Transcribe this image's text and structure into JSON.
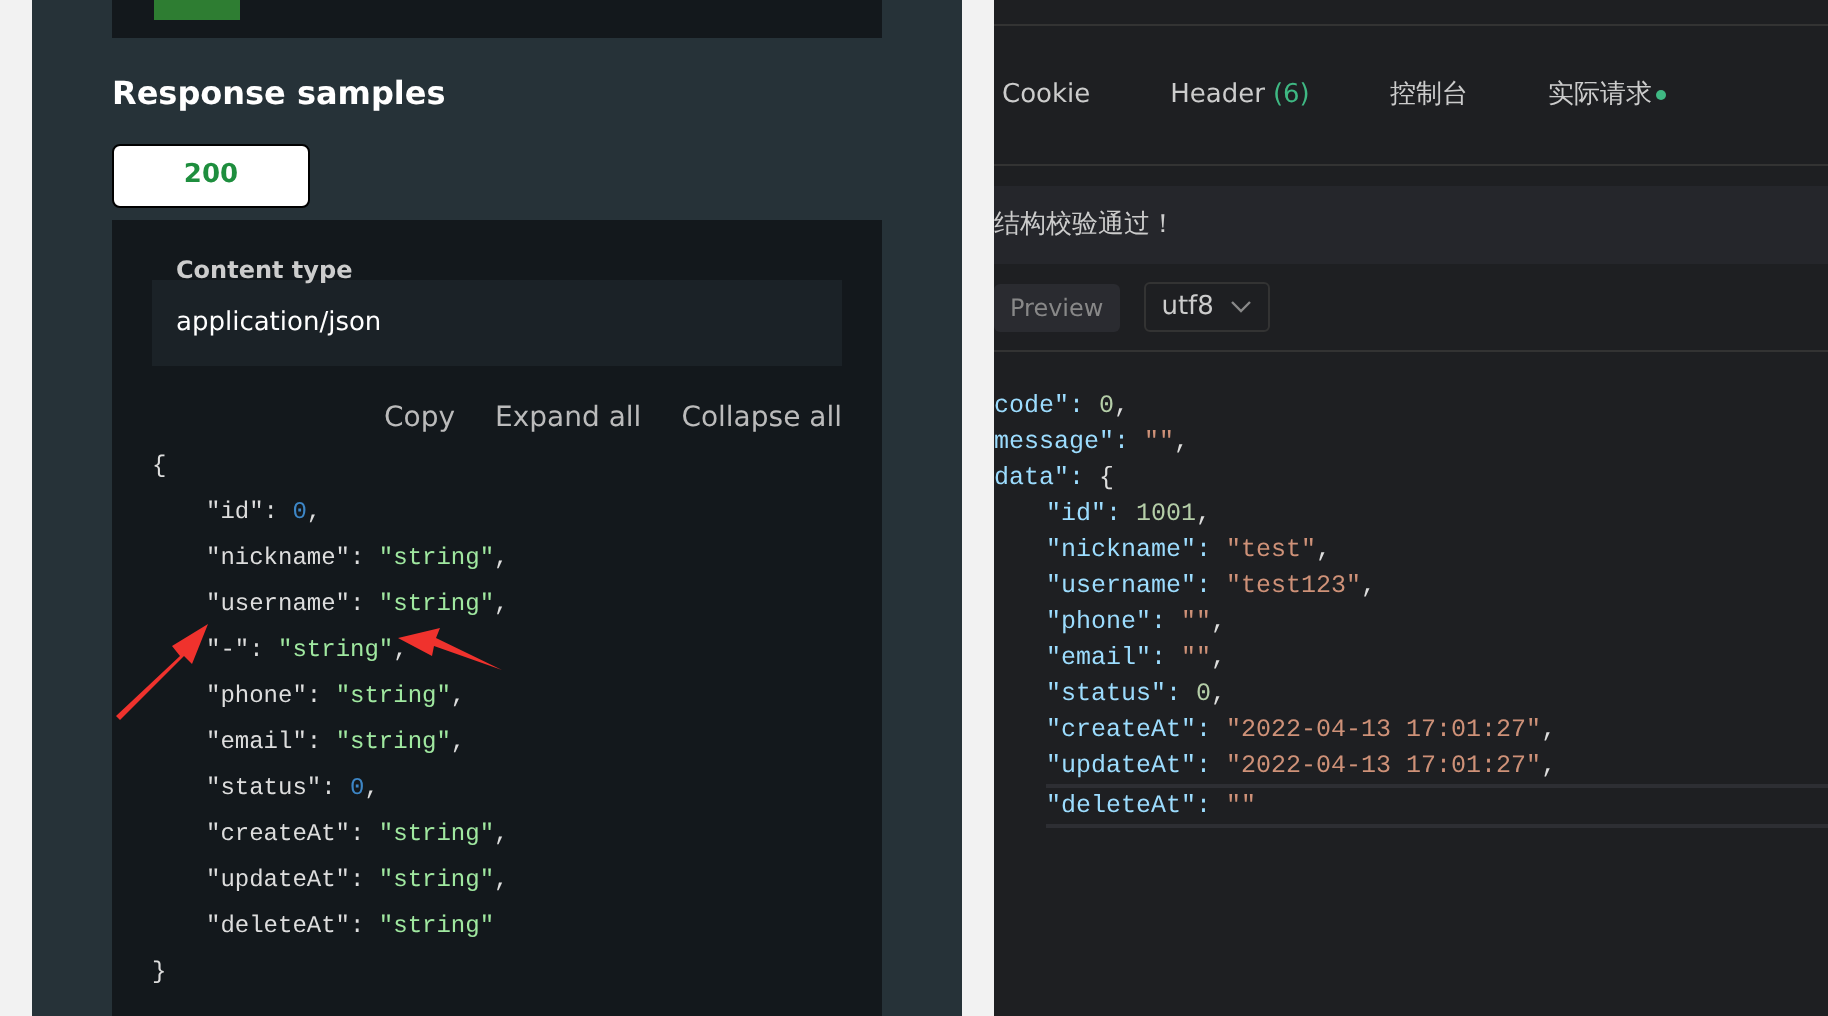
{
  "response_samples": {
    "title": "Response samples",
    "status_tabs": [
      {
        "label": "200",
        "selected": true
      }
    ],
    "content_type": {
      "label": "Content type",
      "value": "application/json"
    },
    "actions": [
      "Copy",
      "Expand all",
      "Collapse all"
    ],
    "code": [
      {
        "text": "{",
        "children": [
          {
            "key": "\"id\":",
            "value": "0",
            "kind": "number",
            "suffix": ","
          },
          {
            "key": "\"nickname\":",
            "value": "\"string\"",
            "kind": "string",
            "suffix": ","
          },
          {
            "key": "\"username\":",
            "value": "\"string\"",
            "kind": "string",
            "suffix": ","
          },
          {
            "key": "\"-\":",
            "value": "\"string\"",
            "kind": "string",
            "suffix": ","
          },
          {
            "key": "\"phone\":",
            "value": "\"string\"",
            "kind": "string",
            "suffix": ","
          },
          {
            "key": "\"email\":",
            "value": "\"string\"",
            "kind": "string",
            "suffix": ","
          },
          {
            "key": "\"status\":",
            "value": "0",
            "kind": "number",
            "suffix": ","
          },
          {
            "key": "\"createAt\":",
            "value": "\"string\"",
            "kind": "string",
            "suffix": ","
          },
          {
            "key": "\"updateAt\":",
            "value": "\"string\"",
            "kind": "string",
            "suffix": ","
          },
          {
            "key": "\"deleteAt\":",
            "value": "\"string\"",
            "kind": "string"
          }
        ]
      },
      {
        "text": "}"
      }
    ]
  },
  "response_panel": {
    "tabs": [
      {
        "label": "Cookie",
        "indicator": false
      },
      {
        "label": "Header",
        "count": "(6)",
        "indicator": false
      },
      {
        "label": "控制台",
        "indicator": false
      },
      {
        "label": "实际请求",
        "indicator": true
      }
    ],
    "banner": "结构校验通过！",
    "preview_button": "Preview",
    "encoding": "utf8",
    "code": [
      {
        "key": "code\":",
        "value": "0",
        "kind": "number",
        "suffix": ",",
        "highlighted": false
      },
      {
        "key": "message\":",
        "value": "\"\"",
        "kind": "string",
        "suffix": ",",
        "highlighted": false
      },
      {
        "key": "data\":",
        "value": "{",
        "kind": "brace",
        "highlighted": false,
        "children": [
          {
            "key": "\"id\":",
            "value": "1001",
            "kind": "number",
            "suffix": ",",
            "highlighted": false
          },
          {
            "key": "\"nickname\":",
            "value": "\"test\"",
            "kind": "string",
            "suffix": ",",
            "highlighted": false
          },
          {
            "key": "\"username\":",
            "value": "\"test123\"",
            "kind": "string",
            "suffix": ",",
            "highlighted": false
          },
          {
            "key": "\"phone\":",
            "value": "\"\"",
            "kind": "string",
            "suffix": ",",
            "highlighted": false
          },
          {
            "key": "\"email\":",
            "value": "\"\"",
            "kind": "string",
            "suffix": ",",
            "highlighted": false
          },
          {
            "key": "\"status\":",
            "value": "0",
            "kind": "number",
            "suffix": ",",
            "highlighted": false
          },
          {
            "key": "\"createAt\":",
            "value": "\"2022-04-13 17:01:27\"",
            "kind": "string",
            "suffix": ",",
            "highlighted": false
          },
          {
            "key": "\"updateAt\":",
            "value": "\"2022-04-13 17:01:27\"",
            "kind": "string",
            "suffix": ",",
            "highlighted": false
          },
          {
            "key": "\"deleteAt\":",
            "value": "\"\"",
            "kind": "string",
            "highlighted": true
          }
        ]
      }
    ]
  }
}
